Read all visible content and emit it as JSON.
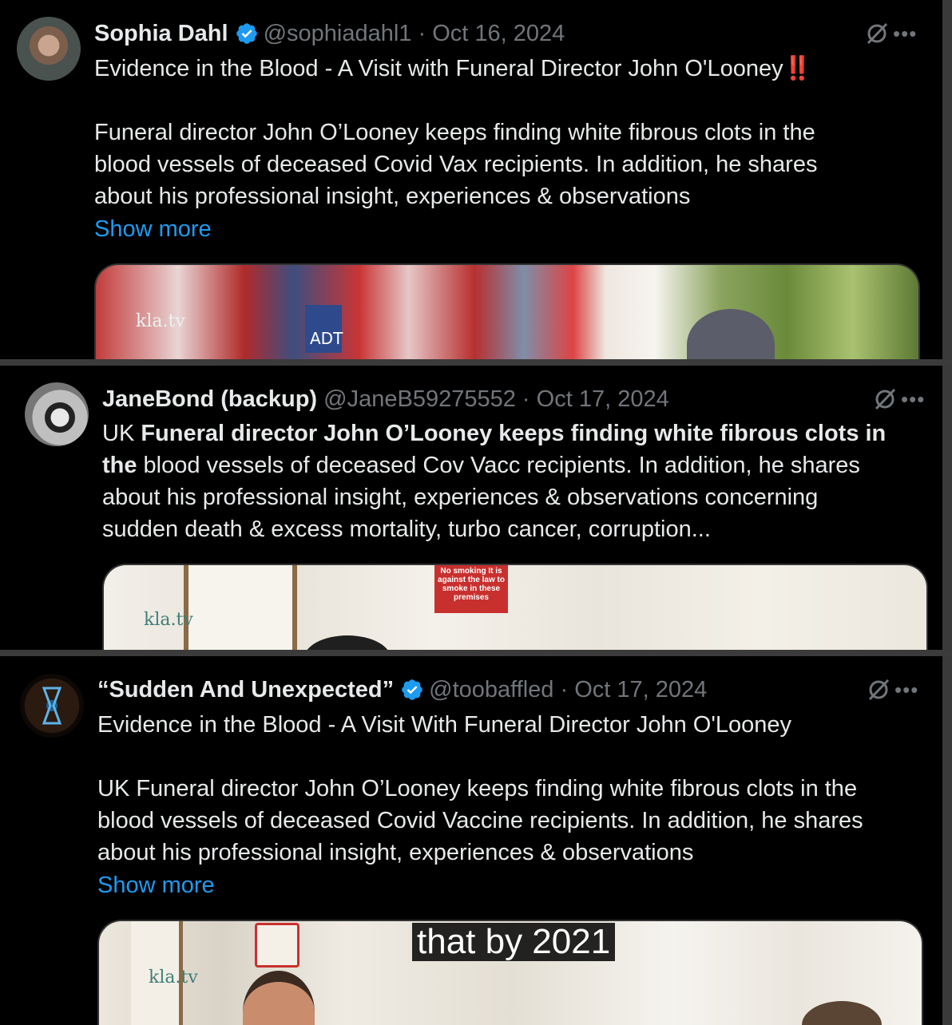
{
  "tweets": [
    {
      "name": "Sophia Dahl",
      "handle": "@sophiadahl1",
      "date": "Oct 16, 2024",
      "title": "Evidence in the Blood - A Visit with Funeral Director John O'Looney",
      "title_emoji": "‼️",
      "body": "Funeral director John O’Looney keeps finding white fibrous clots in the\nblood vessels of deceased Covid Vax recipients. In addition, he shares\nabout his professional insight, experiences & observations",
      "show_more": "Show more",
      "media_watermark": "kla.tv",
      "media_sign": "ADT"
    },
    {
      "name": "JaneBond (backup)",
      "handle": "@JaneB59275552",
      "date": "Oct 17, 2024",
      "body_prefix": "UK ",
      "body_bold": "Funeral director John O’Looney keeps finding white fibrous clots in\nthe",
      "body_rest": " blood vessels of deceased Cov Vacc recipients. In addition, he shares\nabout his professional insight, experiences & observations concerning\nsudden death & excess mortality, turbo cancer, corruption...",
      "media_watermark": "kla.tv",
      "media_sign": "No smoking It is against the law to smoke in these premises"
    },
    {
      "name": "“Sudden And Unexpected”",
      "handle": "@toobaffled",
      "date": "Oct 17, 2024",
      "title": "Evidence in the Blood - A Visit With Funeral Director John O'Looney",
      "body": "UK Funeral director John O’Looney keeps finding white fibrous clots in the\nblood vessels of deceased Covid Vaccine recipients. In addition, he shares\nabout his professional insight, experiences & observations",
      "show_more": "Show more",
      "media_watermark": "kla.tv",
      "media_caption": "that by 2021"
    }
  ],
  "ui": {
    "separator": "·",
    "more_dots": "•••",
    "accent_color": "#1d9bf0",
    "verified_color": "#1d9bf0"
  }
}
